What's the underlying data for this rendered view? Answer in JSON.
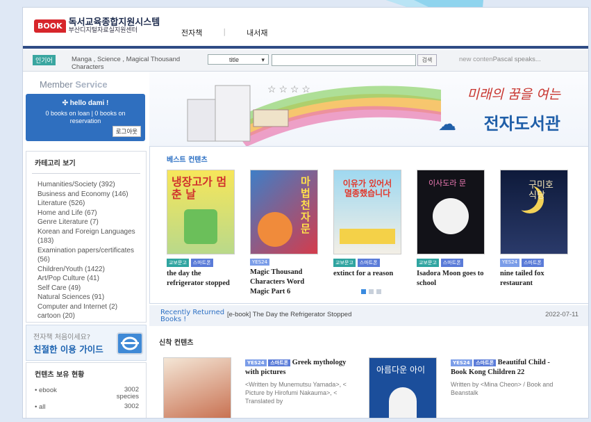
{
  "header": {
    "logo_badge": "BOOK",
    "logo_main": "독서교육종합지원시스템",
    "logo_sub": "부산디지털자료실지원센터",
    "nav": [
      "전자책",
      "내서재"
    ]
  },
  "searchbar": {
    "popular_badge": "인기어",
    "popular_text": "Manga , Science , Magical Thousand Characters",
    "select_value": "title",
    "search_placeholder": "",
    "search_button": "검색",
    "new_content_label": "new conten",
    "new_content_value": "Pascal speaks..."
  },
  "member": {
    "title_a": "Member",
    "title_b": "Service",
    "hello": "hello dami !",
    "loans": "0 books on loan | 0 books on reservation",
    "logout": "로그아웃"
  },
  "categories": {
    "title": "카테고리 보기",
    "items": [
      "Humanities/Society (392)",
      "Business and Economy (146)",
      "Literature (526)",
      "Home and Life (67)",
      "Genre Literature (7)",
      "Korean and Foreign Languages (183)",
      "Examination papers/certificates (56)",
      "Children/Youth (1422)",
      "Art/Pop Culture (41)",
      "Self Care (49)",
      "Natural Sciences (91)",
      "Computer and Internet (2)",
      "cartoon (20)"
    ]
  },
  "guide": {
    "question": "전자책 처음이세요?",
    "main": "친절한 이용 가이드"
  },
  "holdings": {
    "title": "컨텐츠 보유 현황",
    "rows": [
      {
        "label": "ebook",
        "value": "3002 species"
      },
      {
        "label": "all",
        "value": "3002"
      }
    ]
  },
  "banner": {
    "slogan": "미래의 꿈을 여는",
    "title": "전자도서관"
  },
  "best": {
    "title": "베스트 컨텐츠",
    "books": [
      {
        "tags": [
          "교보문고",
          "스마트폰"
        ],
        "title": "the day the refrigerator stopped",
        "cover": "냉장고가 멈춘 날"
      },
      {
        "tags": [
          "YES24"
        ],
        "title": "Magic Thousand Characters Word Magic Part 6",
        "cover": "마법천자문"
      },
      {
        "tags": [
          "교보문고",
          "스마트폰"
        ],
        "title": "extinct for a reason",
        "cover": "이유가 있어서 멸종했습니다"
      },
      {
        "tags": [
          "교보문고",
          "스마트폰"
        ],
        "title": "Isadora Moon goes to school",
        "cover": "이사도라 문"
      },
      {
        "tags": [
          "YES24",
          "스마트폰"
        ],
        "title": "nine tailed fox restaurant",
        "cover": "구미호 식당"
      }
    ]
  },
  "recent": {
    "label": "Recently Returned Books !",
    "item": "[e-book] The Day the Refrigerator Stopped",
    "date": "2022-07-11"
  },
  "new_contents": {
    "title": "신착 컨텐츠",
    "books": [
      {
        "tags": [
          "YES24",
          "스마트폰"
        ],
        "title": "Greek mythology with pictures",
        "author": "<Written by Munemutsu Yamada>, < Picture by Hirofumi Nakauma>, < Translated by"
      },
      {
        "tags": [
          "YES24",
          "스마트폰"
        ],
        "title": "Beautiful Child - Book Kong Children 22",
        "author": "Written by <Mina Cheon> / Book and Beanstalk",
        "cover": "아름다운 아이"
      }
    ]
  }
}
